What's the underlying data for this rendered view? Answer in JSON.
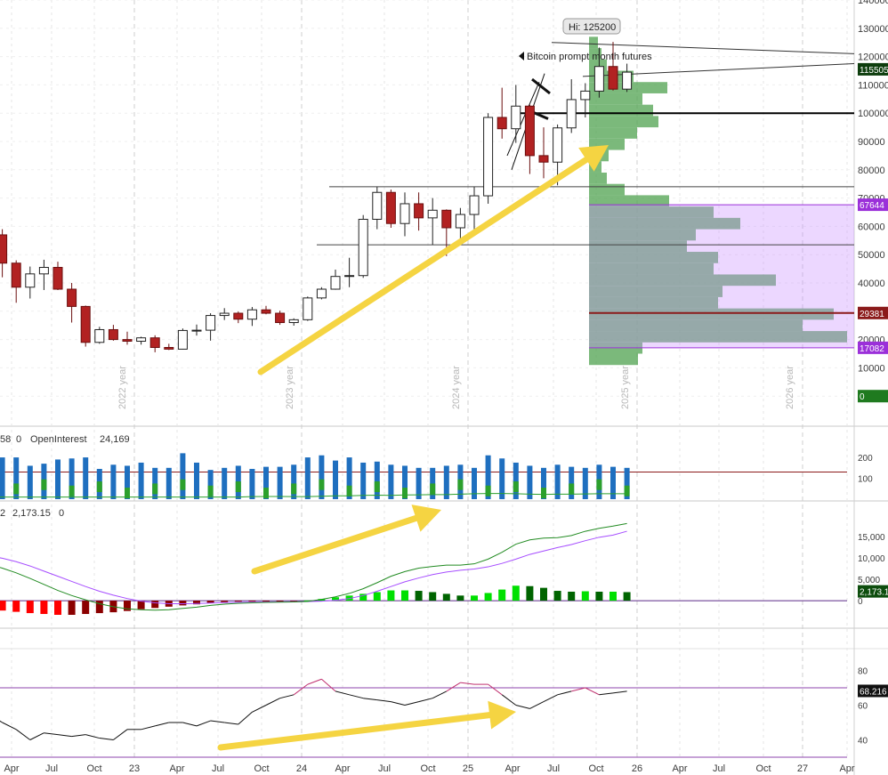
{
  "chart_data": [
    {
      "panel": "price",
      "type": "candlestick",
      "timeframe": "monthly",
      "annotation": "Bitcoin prompt month futures",
      "high_callout": "Hi: 125200",
      "y_ticks": [
        "0",
        "10000",
        "20000",
        "30000",
        "40000",
        "50000",
        "60000",
        "70000",
        "80000",
        "90000",
        "100000",
        "110000",
        "120000",
        "130000",
        "140000"
      ],
      "ylim": [
        -10000,
        140000
      ],
      "year_labels": [
        "2022 year",
        "2023 year",
        "2024 year",
        "2025 year",
        "2026 year"
      ],
      "price_tags": [
        {
          "label": "115505",
          "value": 115505,
          "color": "#0d3d0d"
        },
        {
          "label": "67644",
          "value": 67644,
          "color": "#9b30d9"
        },
        {
          "label": "29381",
          "value": 29381,
          "color": "#8b1a1a"
        },
        {
          "label": "17082",
          "value": 17082,
          "color": "#9b30d9"
        },
        {
          "label": "0",
          "value": 0,
          "color": "#1f7a1f"
        }
      ],
      "horizontal_levels": [
        {
          "value": 100000,
          "style": "thick"
        },
        {
          "value": 74000,
          "style": "thin"
        },
        {
          "value": 53500,
          "style": "thin"
        },
        {
          "value": 67644,
          "style": "purple"
        },
        {
          "value": 17082,
          "style": "purple"
        },
        {
          "value": 29381,
          "style": "red"
        }
      ],
      "candles": [
        {
          "m": "2021-11",
          "o": 61000,
          "h": 69000,
          "l": 53500,
          "c": 57000
        },
        {
          "m": "2021-12",
          "o": 57000,
          "h": 59000,
          "l": 42000,
          "c": 47000
        },
        {
          "m": "2022-01",
          "o": 47000,
          "h": 48000,
          "l": 33000,
          "c": 38500
        },
        {
          "m": "2022-02",
          "o": 38500,
          "h": 45800,
          "l": 34500,
          "c": 43200
        },
        {
          "m": "2022-03",
          "o": 43200,
          "h": 48200,
          "l": 37500,
          "c": 45500
        },
        {
          "m": "2022-04",
          "o": 45500,
          "h": 47500,
          "l": 37500,
          "c": 37800
        },
        {
          "m": "2022-05",
          "o": 37800,
          "h": 40000,
          "l": 26000,
          "c": 31700
        },
        {
          "m": "2022-06",
          "o": 31700,
          "h": 32000,
          "l": 17500,
          "c": 19000
        },
        {
          "m": "2022-07",
          "o": 19000,
          "h": 24500,
          "l": 18500,
          "c": 23500
        },
        {
          "m": "2022-08",
          "o": 23500,
          "h": 25200,
          "l": 19600,
          "c": 20000
        },
        {
          "m": "2022-09",
          "o": 20000,
          "h": 22800,
          "l": 18200,
          "c": 19400
        },
        {
          "m": "2022-10",
          "o": 19400,
          "h": 21000,
          "l": 18200,
          "c": 20600
        },
        {
          "m": "2022-11",
          "o": 20600,
          "h": 21500,
          "l": 15500,
          "c": 17200
        },
        {
          "m": "2022-12",
          "o": 17200,
          "h": 18500,
          "l": 16300,
          "c": 16600
        },
        {
          "m": "2023-01",
          "o": 16600,
          "h": 23900,
          "l": 16500,
          "c": 23200
        },
        {
          "m": "2023-02",
          "o": 23200,
          "h": 25300,
          "l": 21400,
          "c": 23300
        },
        {
          "m": "2023-03",
          "o": 23300,
          "h": 29300,
          "l": 19600,
          "c": 28500
        },
        {
          "m": "2023-04",
          "o": 28500,
          "h": 31100,
          "l": 26900,
          "c": 29300
        },
        {
          "m": "2023-05",
          "o": 29300,
          "h": 29900,
          "l": 25800,
          "c": 27200
        },
        {
          "m": "2023-06",
          "o": 27200,
          "h": 31500,
          "l": 24800,
          "c": 30500
        },
        {
          "m": "2023-07",
          "o": 30500,
          "h": 31900,
          "l": 28900,
          "c": 29300
        },
        {
          "m": "2023-08",
          "o": 29300,
          "h": 30200,
          "l": 25200,
          "c": 26000
        },
        {
          "m": "2023-09",
          "o": 26000,
          "h": 27500,
          "l": 24900,
          "c": 27000
        },
        {
          "m": "2023-10",
          "o": 27000,
          "h": 35200,
          "l": 26600,
          "c": 34700
        },
        {
          "m": "2023-11",
          "o": 34700,
          "h": 38500,
          "l": 34200,
          "c": 37800
        },
        {
          "m": "2023-12",
          "o": 37800,
          "h": 44700,
          "l": 37600,
          "c": 42300
        },
        {
          "m": "2024-01",
          "o": 42300,
          "h": 48900,
          "l": 38500,
          "c": 42600
        },
        {
          "m": "2024-02",
          "o": 42600,
          "h": 64000,
          "l": 41800,
          "c": 62500
        },
        {
          "m": "2024-03",
          "o": 62500,
          "h": 74000,
          "l": 59000,
          "c": 72000
        },
        {
          "m": "2024-04",
          "o": 72000,
          "h": 73000,
          "l": 59500,
          "c": 61000
        },
        {
          "m": "2024-05",
          "o": 61000,
          "h": 72000,
          "l": 56500,
          "c": 68000
        },
        {
          "m": "2024-06",
          "o": 68000,
          "h": 72000,
          "l": 58500,
          "c": 63000
        },
        {
          "m": "2024-07",
          "o": 63000,
          "h": 70000,
          "l": 53500,
          "c": 65700
        },
        {
          "m": "2024-08",
          "o": 65700,
          "h": 66000,
          "l": 49500,
          "c": 59500
        },
        {
          "m": "2024-09",
          "o": 59500,
          "h": 66500,
          "l": 53500,
          "c": 64200
        },
        {
          "m": "2024-10",
          "o": 64200,
          "h": 74000,
          "l": 58800,
          "c": 70800
        },
        {
          "m": "2024-11",
          "o": 70800,
          "h": 100000,
          "l": 68000,
          "c": 98500
        },
        {
          "m": "2024-12",
          "o": 98500,
          "h": 109000,
          "l": 91000,
          "c": 94500
        },
        {
          "m": "2025-01",
          "o": 94500,
          "h": 110000,
          "l": 89500,
          "c": 102500
        },
        {
          "m": "2025-02",
          "o": 102500,
          "h": 103000,
          "l": 78500,
          "c": 85000
        },
        {
          "m": "2025-03",
          "o": 85000,
          "h": 95000,
          "l": 77000,
          "c": 82700
        },
        {
          "m": "2025-04",
          "o": 82700,
          "h": 96000,
          "l": 74500,
          "c": 94800
        },
        {
          "m": "2025-05",
          "o": 94800,
          "h": 112000,
          "l": 93000,
          "c": 104800
        },
        {
          "m": "2025-06",
          "o": 104800,
          "h": 110600,
          "l": 98500,
          "c": 107800
        },
        {
          "m": "2025-07",
          "o": 107800,
          "h": 123200,
          "l": 105500,
          "c": 116500
        },
        {
          "m": "2025-08",
          "o": 116500,
          "h": 125200,
          "l": 108000,
          "c": 108500
        },
        {
          "m": "2025-09",
          "o": 108500,
          "h": 117500,
          "l": 107500,
          "c": 114500
        }
      ],
      "volume_profile_note": "horizontal histogram at right of price panel"
    },
    {
      "panel": "volume_openinterest",
      "type": "bar",
      "header": [
        "58",
        "0",
        "OpenInterest",
        "24,169"
      ],
      "y_ticks": [
        "100",
        "200"
      ],
      "ylim": [
        0,
        260
      ],
      "reference_level": 130,
      "series": [
        {
          "values": [
            125,
            200,
            200,
            160,
            170,
            190,
            195,
            200,
            145,
            165,
            160,
            175,
            150,
            150,
            220,
            175,
            140,
            150,
            160,
            145,
            155,
            155,
            165,
            200,
            210,
            185,
            200,
            175,
            180,
            165,
            160,
            150,
            150,
            160,
            165,
            150,
            210,
            195,
            175,
            160,
            150,
            165,
            155,
            150,
            165,
            155,
            150
          ]
        }
      ],
      "oi_line": [
        10,
        10,
        10,
        10,
        10,
        10,
        10,
        10,
        10,
        10,
        10,
        10,
        10,
        10,
        10,
        10,
        10,
        10,
        10,
        12,
        13,
        13,
        12,
        12,
        14,
        16,
        16,
        18,
        19,
        18,
        20,
        21,
        22,
        22,
        24,
        26,
        27,
        27,
        26,
        24,
        23,
        24,
        24,
        25,
        26,
        26,
        26
      ]
    },
    {
      "panel": "macd",
      "type": "line+histogram",
      "header": [
        "2",
        "2,173.15",
        "0"
      ],
      "y_ticks": [
        "0",
        "5,000",
        "10,000",
        "15,000"
      ],
      "ylim": [
        -6000,
        18500
      ],
      "value_tag": "2,173.15",
      "series": [
        {
          "name": "fast",
          "values": [
            8500,
            7600,
            6500,
            5200,
            3800,
            2400,
            1200,
            200,
            -700,
            -1400,
            -1900,
            -2100,
            -2200,
            -2100,
            -1800,
            -1500,
            -1100,
            -800,
            -600,
            -500,
            -400,
            -350,
            -300,
            -150,
            300,
            900,
            1700,
            2800,
            4200,
            5700,
            6800,
            7600,
            8000,
            8300,
            8300,
            8600,
            9700,
            11300,
            13200,
            14200,
            14600,
            14700,
            15200,
            16200,
            16900,
            17400,
            18000
          ]
        },
        {
          "name": "slow",
          "values": [
            10500,
            9900,
            9100,
            8100,
            6900,
            5700,
            4500,
            3300,
            2200,
            1300,
            500,
            -100,
            -500,
            -700,
            -700,
            -650,
            -550,
            -450,
            -380,
            -330,
            -300,
            -280,
            -250,
            -200,
            -100,
            100,
            500,
            1200,
            2200,
            3300,
            4400,
            5300,
            6100,
            6700,
            7100,
            7400,
            7900,
            8700,
            9700,
            10800,
            11600,
            12400,
            13100,
            14000,
            14800,
            15300,
            16200
          ]
        }
      ],
      "histogram": [
        -2000,
        -2300,
        -2600,
        -2900,
        -3100,
        -3300,
        -3300,
        -3100,
        -2900,
        -2700,
        -2400,
        -2000,
        -1700,
        -1400,
        -1100,
        -850,
        -550,
        -350,
        -220,
        -170,
        -100,
        -70,
        -50,
        50,
        400,
        800,
        1200,
        1600,
        2000,
        2400,
        2400,
        2300,
        2000,
        1600,
        1200,
        1200,
        1800,
        2600,
        3500,
        3400,
        3000,
        2300,
        2100,
        2200,
        2100,
        2100,
        2000
      ]
    },
    {
      "panel": "rsi",
      "type": "line",
      "y_ticks": [
        "40",
        "60",
        "80"
      ],
      "ylim": [
        30,
        90
      ],
      "reference_level": 70,
      "value_tag": "68.216",
      "series": [
        {
          "values": [
            55,
            50,
            46,
            40,
            44,
            43,
            42,
            43,
            41,
            40,
            46,
            46,
            48,
            50,
            50,
            48,
            51,
            50,
            49,
            56,
            60,
            64,
            66,
            72,
            75,
            68,
            66,
            64,
            63,
            62,
            60,
            62,
            64,
            68,
            73,
            72,
            72,
            66,
            60,
            58,
            62,
            66,
            68,
            70,
            66,
            67,
            68
          ]
        }
      ]
    }
  ],
  "x_axis": {
    "labels": [
      "Apr",
      "Jul",
      "Oct",
      "23",
      "Apr",
      "Jul",
      "Oct",
      "24",
      "Apr",
      "Jul",
      "Oct",
      "25",
      "Apr",
      "Jul",
      "Oct",
      "26",
      "Apr",
      "Jul",
      "Oct",
      "27",
      "Apr"
    ]
  },
  "colors": {
    "up_candle": "#ffffff",
    "down_candle": "#b22222",
    "volume_bar": "#1f6fbf",
    "oi_green": "#2ca02c",
    "macd_fast": "#228b22",
    "macd_slow": "#a64dff",
    "hist_red": "#ff0000",
    "hist_darkred": "#8b0000",
    "hist_green": "#00e000",
    "hist_darkgreen": "#006400",
    "rsi_line": "#111111",
    "rsi_overbought": "#c0306f",
    "arrow": "#f5d442",
    "profile_green": "#5aa85a",
    "profile_purple": "#c88cff"
  }
}
